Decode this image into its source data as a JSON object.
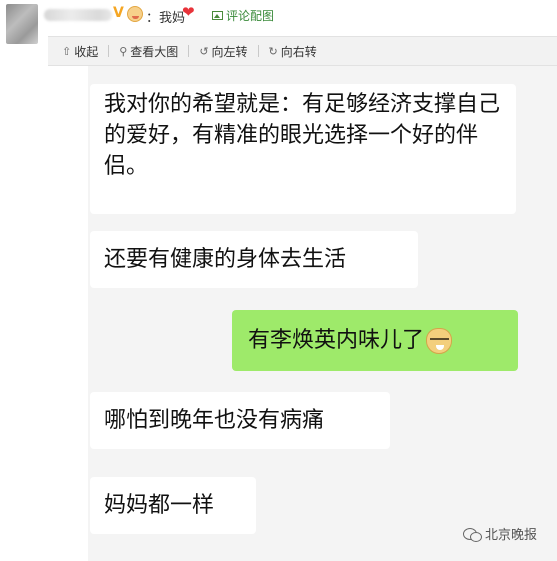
{
  "header": {
    "verified_badge": "V",
    "text": "：我妈",
    "comment_pic_label": "评论配图"
  },
  "toolbar": {
    "collapse": "收起",
    "view_large": "查看大图",
    "rotate_left": "向左转",
    "rotate_right": "向右转"
  },
  "messages": [
    {
      "side": "left",
      "text": "我对你的希望就是：有足够经济支撑自己的爱好，有精准的眼光选择一个好的伴侣。"
    },
    {
      "side": "left",
      "text": "还要有健康的身体去生活"
    },
    {
      "side": "right",
      "text": "有李焕英内味儿了"
    },
    {
      "side": "left",
      "text": "哪怕到晚年也没有病痛"
    },
    {
      "side": "left",
      "text": "妈妈都一样"
    }
  ],
  "watermark": "北京晚报"
}
